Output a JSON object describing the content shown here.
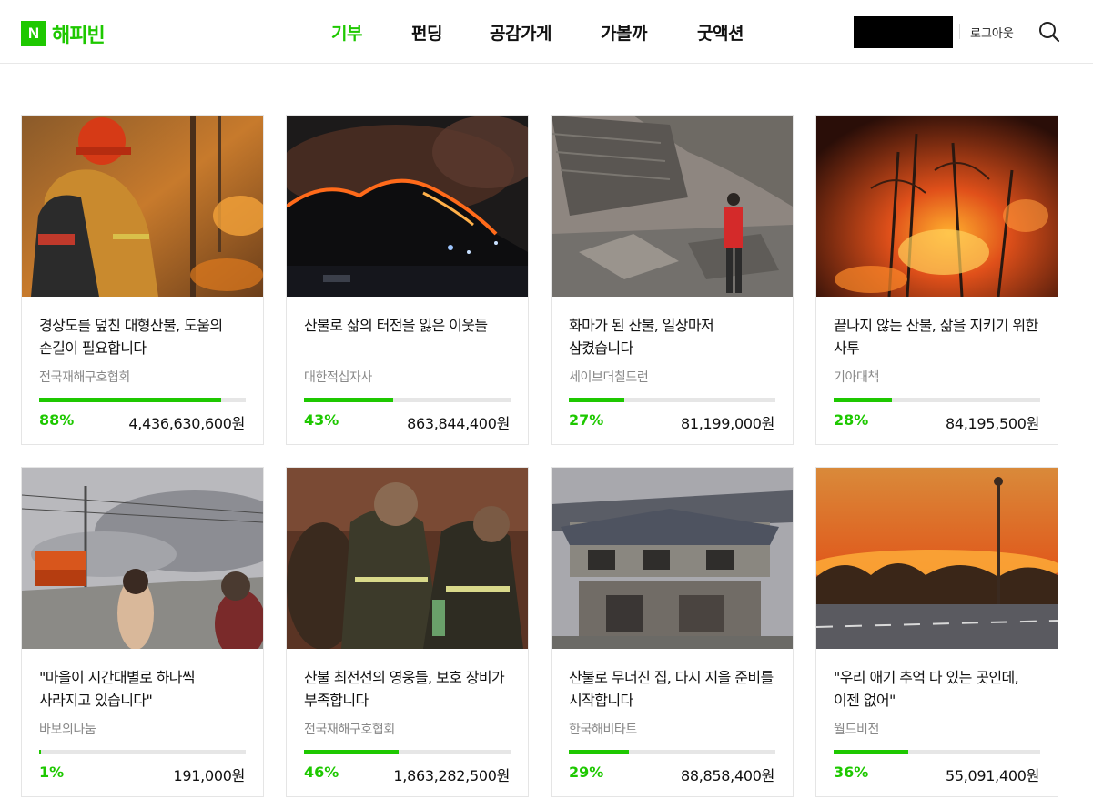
{
  "header": {
    "logo_mark": "N",
    "logo_text": "해피빈",
    "nav": [
      {
        "label": "기부",
        "active": true
      },
      {
        "label": "펀딩",
        "active": false
      },
      {
        "label": "공감가게",
        "active": false
      },
      {
        "label": "가볼까",
        "active": false
      },
      {
        "label": "굿액션",
        "active": false
      }
    ],
    "logout_label": "로그아웃",
    "search_icon": "search-icon"
  },
  "colors": {
    "brand_green": "#1ec800",
    "progress_track": "#e6e6e6",
    "org_text": "#888888"
  },
  "cards": [
    {
      "title": "경상도를 덮친 대형산불, 도움의 손길이 필요합니다",
      "org": "전국재해구호협회",
      "percent": 88,
      "percent_label": "88%",
      "amount": "4,436,630,600원",
      "image": "firefighter-in-forest-fire-photo"
    },
    {
      "title": "산불로 삶의 터전을 잃은 이웃들",
      "org": "대한적십자사",
      "percent": 43,
      "percent_label": "43%",
      "amount": "863,844,400원",
      "image": "mountain-fire-at-night-photo"
    },
    {
      "title": "화마가 된 산불, 일상마저 삼켰습니다",
      "org": "세이브더칠드런",
      "percent": 27,
      "percent_label": "27%",
      "amount": "81,199,000원",
      "image": "collapsed-house-ruins-photo"
    },
    {
      "title": "끝나지 않는 산불, 삶을 지키기 위한 사투",
      "org": "기아대책",
      "percent": 28,
      "percent_label": "28%",
      "amount": "84,195,500원",
      "image": "burning-forest-photo"
    },
    {
      "title": "\"마을이 시간대별로 하나씩 사라지고 있습니다\"",
      "org": "바보의나눔",
      "percent": 1,
      "percent_label": "1%",
      "amount": "191,000원",
      "image": "villagers-watching-smoke-photo"
    },
    {
      "title": "산불 최전선의 영웅들, 보호 장비가 부족합니다",
      "org": "전국재해구호협회",
      "percent": 46,
      "percent_label": "46%",
      "amount": "1,863,282,500원",
      "image": "exhausted-firefighters-photo"
    },
    {
      "title": "산불로 무너진 집, 다시 지을 준비를 시작합니다",
      "org": "한국해비타트",
      "percent": 29,
      "percent_label": "29%",
      "amount": "88,858,400원",
      "image": "burned-house-photo"
    },
    {
      "title": "\"우리 애기 추억 다 있는 곳인데, 이젠 없어\"",
      "org": "월드비전",
      "percent": 36,
      "percent_label": "36%",
      "amount": "55,091,400원",
      "image": "wildfire-by-road-photo"
    }
  ]
}
